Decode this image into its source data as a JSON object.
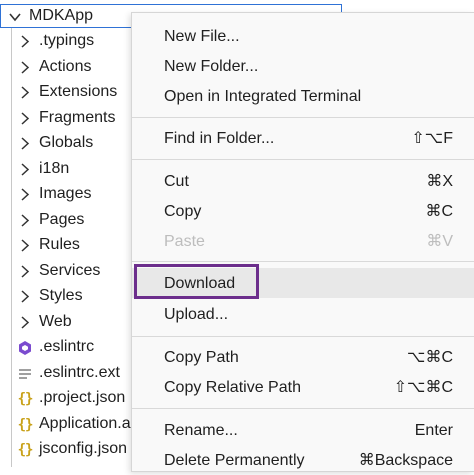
{
  "explorer": {
    "root": {
      "label": "MDKApp",
      "icon": "chevron-down-icon"
    },
    "items": [
      {
        "label": ".typings",
        "icon": "chevron-right-icon"
      },
      {
        "label": "Actions",
        "icon": "chevron-right-icon"
      },
      {
        "label": "Extensions",
        "icon": "chevron-right-icon"
      },
      {
        "label": "Fragments",
        "icon": "chevron-right-icon"
      },
      {
        "label": "Globals",
        "icon": "chevron-right-icon"
      },
      {
        "label": "i18n",
        "icon": "chevron-right-icon"
      },
      {
        "label": "Images",
        "icon": "chevron-right-icon"
      },
      {
        "label": "Pages",
        "icon": "chevron-right-icon"
      },
      {
        "label": "Rules",
        "icon": "chevron-right-icon"
      },
      {
        "label": "Services",
        "icon": "chevron-right-icon"
      },
      {
        "label": "Styles",
        "icon": "chevron-right-icon"
      },
      {
        "label": "Web",
        "icon": "chevron-right-icon"
      },
      {
        "label": ".eslintrc",
        "icon": "eslint-icon"
      },
      {
        "label": ".eslintrc.ext",
        "icon": "lines-file-icon"
      },
      {
        "label": ".project.json",
        "icon": "json-braces-icon",
        "glyph": "{}"
      },
      {
        "label": "Application.app",
        "icon": "json-braces-icon",
        "glyph": "{}"
      },
      {
        "label": "jsconfig.json",
        "icon": "json-braces-icon",
        "glyph": "{}"
      }
    ]
  },
  "context_menu": {
    "items": [
      {
        "label": "New File...",
        "shortcut": ""
      },
      {
        "label": "New Folder...",
        "shortcut": ""
      },
      {
        "label": "Open in Integrated Terminal",
        "shortcut": ""
      },
      {
        "label": "Find in Folder...",
        "shortcut": "⇧⌥F"
      },
      {
        "label": "Cut",
        "shortcut": "⌘X"
      },
      {
        "label": "Copy",
        "shortcut": "⌘C"
      },
      {
        "label": "Paste",
        "shortcut": "⌘V",
        "disabled": true
      },
      {
        "label": "Download",
        "shortcut": "",
        "highlighted": true
      },
      {
        "label": "Upload...",
        "shortcut": ""
      },
      {
        "label": "Copy Path",
        "shortcut": "⌥⌘C"
      },
      {
        "label": "Copy Relative Path",
        "shortcut": "⇧⌥⌘C"
      },
      {
        "label": "Rename...",
        "shortcut": "Enter"
      },
      {
        "label": "Delete Permanently",
        "shortcut": "⌘Backspace"
      }
    ]
  },
  "colors": {
    "selection_border": "#2f72d6",
    "highlight_outline": "#6c2e8c",
    "eslint_icon": "#7b4bcf",
    "json_icon": "#c9a21b",
    "disabled_text": "#bdbdbd"
  }
}
